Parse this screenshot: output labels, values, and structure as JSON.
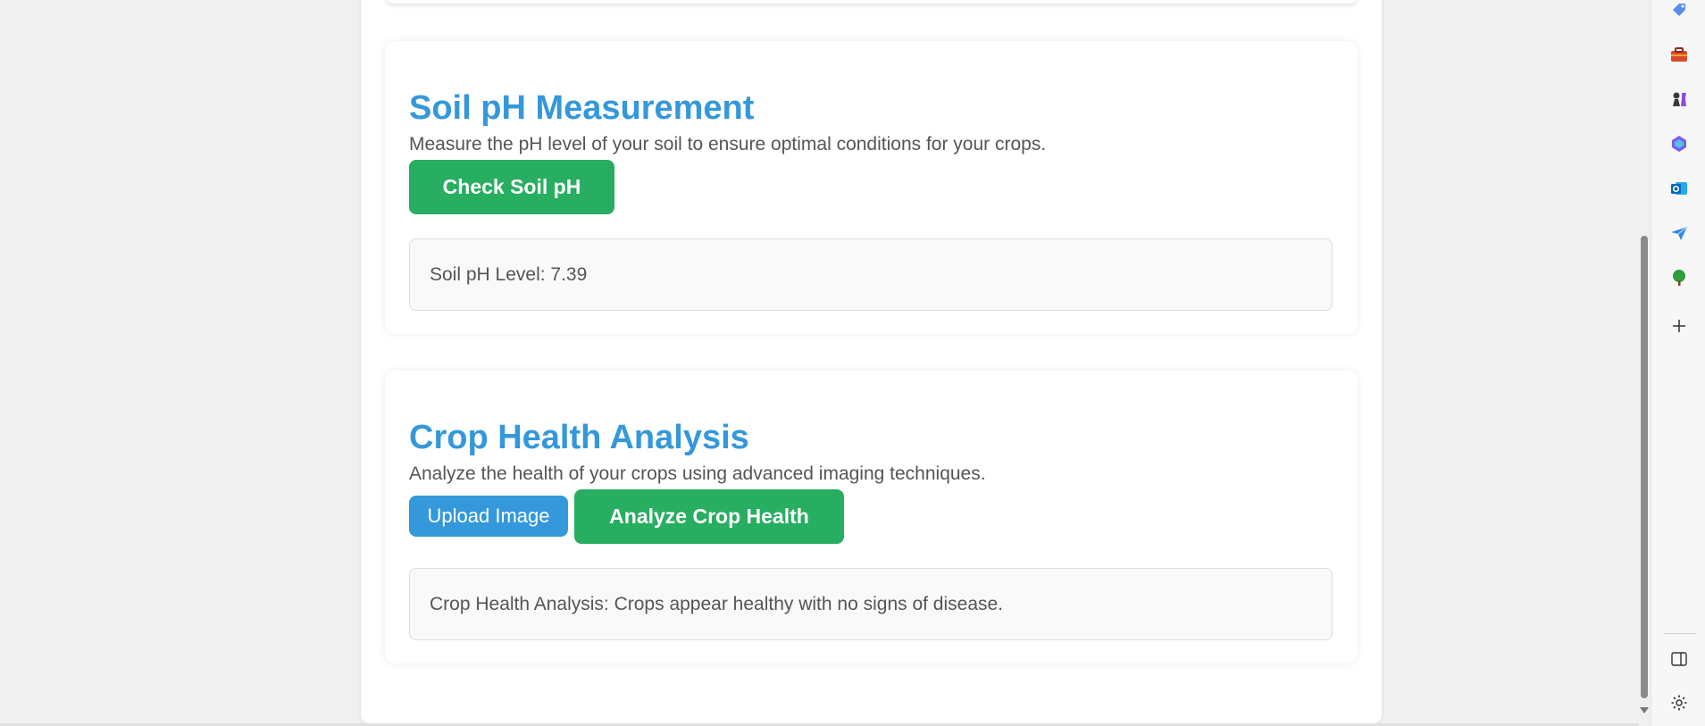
{
  "soil_ph": {
    "title": "Soil pH Measurement",
    "description": "Measure the pH level of your soil to ensure optimal conditions for your crops.",
    "check_button": "Check Soil pH",
    "result": "Soil pH Level: 7.39"
  },
  "crop_health": {
    "title": "Crop Health Analysis",
    "description": "Analyze the health of your crops using advanced imaging techniques.",
    "upload_button": "Upload Image",
    "analyze_button": "Analyze Crop Health",
    "result": "Crop Health Analysis: Crops appear healthy with no signs of disease."
  },
  "sidebar": {
    "icons": [
      "tag-icon",
      "toolbox-icon",
      "chess-icon",
      "copilot-icon",
      "outlook-icon",
      "send-icon",
      "tree-icon",
      "add-icon",
      "panel-toggle-icon",
      "settings-icon"
    ]
  },
  "colors": {
    "heading": "#3498db",
    "primary_button": "#27ae60",
    "secondary_button": "#3498db"
  }
}
